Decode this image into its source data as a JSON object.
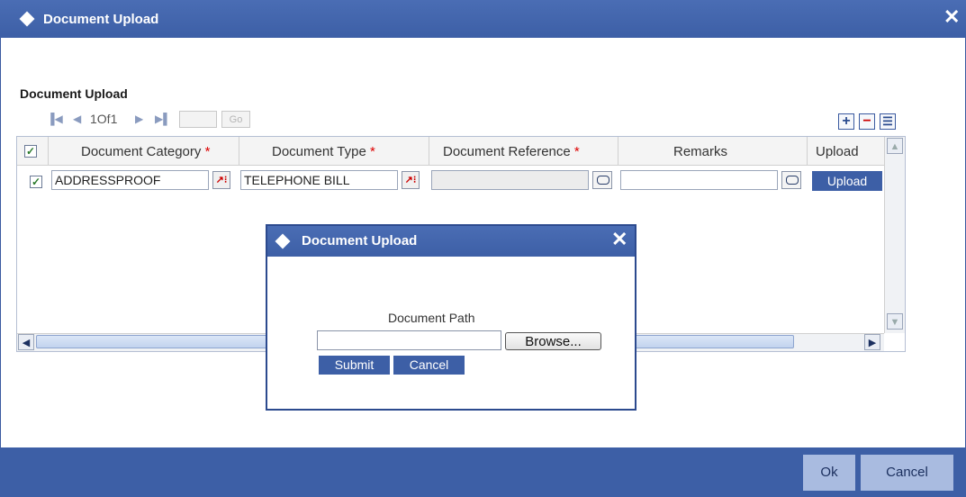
{
  "window": {
    "title": "Document Upload",
    "close_symbol": "✕"
  },
  "section": {
    "title": "Document Upload"
  },
  "pager": {
    "first_symbol": "▐◀",
    "prev_symbol": "◀",
    "page_text": "1Of1",
    "next_symbol": "▶",
    "last_symbol": "▶▌",
    "go_label": "Go"
  },
  "toolbar": {
    "add_symbol": "+",
    "remove_symbol": "−",
    "view_symbol": "☰"
  },
  "grid": {
    "headers": {
      "category": "Document Category",
      "type": "Document Type",
      "reference": "Document Reference",
      "remarks": "Remarks",
      "upload": "Upload"
    },
    "required_mark": "*",
    "rows": [
      {
        "category": "ADDRESSPROOF",
        "type": "TELEPHONE BILL",
        "reference": "",
        "remarks": "",
        "upload_label": "Upload"
      }
    ],
    "check_symbol": "✓",
    "lov_symbol": "↗⁝",
    "scroll_up": "▲",
    "scroll_down": "▼",
    "scroll_left": "◀",
    "scroll_right": "▶"
  },
  "dialog": {
    "title": "Document Upload",
    "close_symbol": "✕",
    "path_label": "Document Path",
    "browse_label": "Browse...",
    "submit_label": "Submit",
    "cancel_label": "Cancel"
  },
  "footer": {
    "ok_label": "Ok",
    "cancel_label": "Cancel"
  },
  "colors": {
    "brand_blue": "#3d5fa6",
    "footer_button": "#a9bbe0"
  }
}
